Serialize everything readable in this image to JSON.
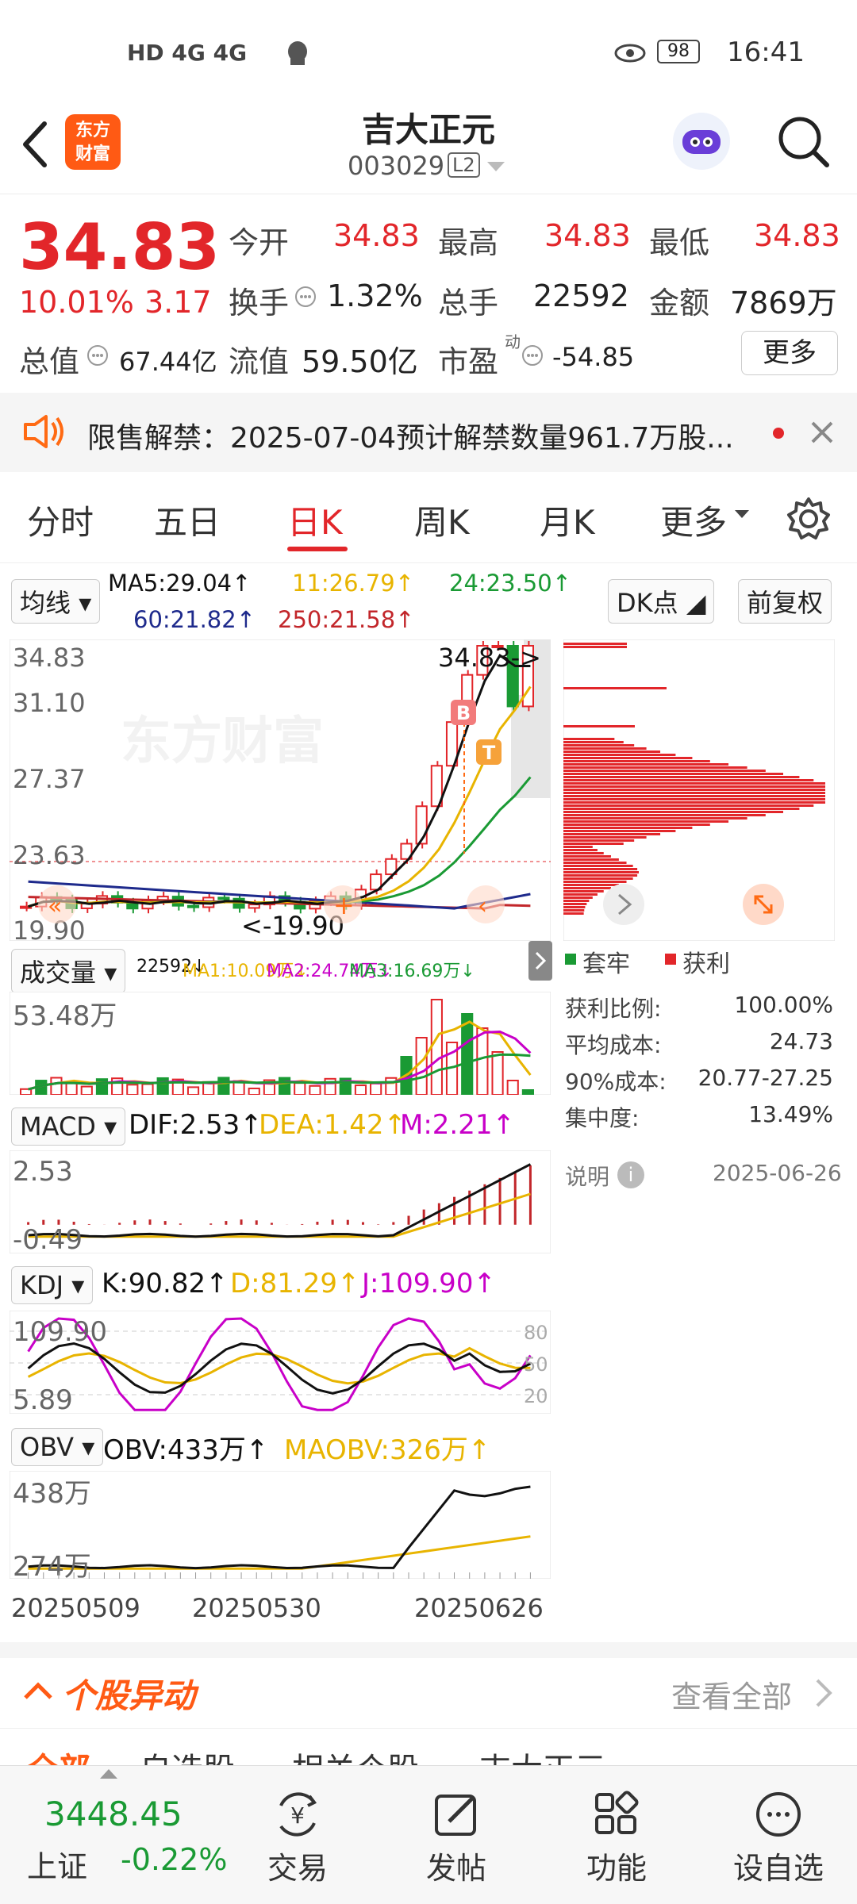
{
  "status": {
    "left_icons": "HD 4G 4G",
    "battery": "98",
    "time": "16:41"
  },
  "header": {
    "title": "吉大正元",
    "code": "003029",
    "level": "L2",
    "logo_text_1": "东方",
    "logo_text_2": "财富"
  },
  "quote": {
    "price": "34.83",
    "change_pct": "10.01%",
    "change": "3.17",
    "open_label": "今开",
    "open": "34.83",
    "high_label": "最高",
    "high": "34.83",
    "low_label": "最低",
    "low": "34.83",
    "turnover_label": "换手",
    "turnover": "1.32%",
    "volume_label": "总手",
    "volume": "22592",
    "amount_label": "金额",
    "amount": "7869万",
    "mktcap_label": "总值",
    "mktcap": "67.44亿",
    "float_label": "流值",
    "float": "59.50亿",
    "pe_label": "市盈",
    "pe_sup": "动",
    "pe": "-54.85",
    "more": "更多"
  },
  "notice": {
    "text": "限售解禁：2025-07-04预计解禁数量961.7万股..."
  },
  "tabs": [
    "分时",
    "五日",
    "日K",
    "周K",
    "月K",
    "更多",
    "设置"
  ],
  "ma": {
    "type": "均线",
    "ma5": "MA5:29.04↑",
    "ma11": "11:26.79↑",
    "ma24": "24:23.50↑",
    "ma60": "60:21.82↑",
    "ma250": "250:21.58↑",
    "dk": "DK点",
    "fq": "前复权"
  },
  "kline": {
    "p_top": "34.83",
    "p2": "31.10",
    "p3": "27.37",
    "p4": "23.63",
    "p_low": "19.90",
    "last_marker": "34.83->",
    "low_marker": "<-19.90",
    "b": "B",
    "t": "T",
    "watermark": "东方财富"
  },
  "vol": {
    "type": "成交量",
    "legend": "22592↓",
    "ma1": "MA1:10.09万↓",
    "ma2": "MA2:24.74万↓",
    "ma3": "MA3:16.69万↓",
    "max": "53.48万"
  },
  "macd": {
    "type": "MACD",
    "dif": "DIF:2.53↑",
    "dea": "DEA:1.42↑",
    "m": "M:2.21↑",
    "max": "2.53",
    "min": "-0.49"
  },
  "kdj": {
    "type": "KDJ",
    "k": "K:90.82↑",
    "d": "D:81.29↑",
    "j": "J:109.90↑",
    "max": "109.90",
    "min": "5.89",
    "l80": "80",
    "l50": "50",
    "l20": "20"
  },
  "obv": {
    "type": "OBV",
    "obv": "OBV:433万↑",
    "maobv": "MAOBV:326万↑",
    "max": "438万",
    "min": "274万"
  },
  "dates": [
    "20250509",
    "20250530",
    "20250626"
  ],
  "chips": {
    "legend_trap": "套牢",
    "legend_profit": "获利",
    "rows": [
      {
        "label": "获利比例:",
        "value": "100.00%"
      },
      {
        "label": "平均成本:",
        "value": "24.73"
      },
      {
        "label": "90%成本:",
        "value": "20.77-27.25"
      },
      {
        "label": "集中度:",
        "value": "13.49%"
      }
    ],
    "note_label": "说明",
    "note_date": "2025-06-26"
  },
  "movement": {
    "title": "个股异动",
    "view_all": "查看全部"
  },
  "subtabs": [
    "全部",
    "自选股",
    "相关个股",
    "吉大正元"
  ],
  "bottom": {
    "index_value": "3448.45",
    "index_name": "上证",
    "index_change": "-0.22%",
    "items": [
      "交易",
      "发帖",
      "功能",
      "设自选"
    ]
  },
  "colors": {
    "up": "#e2262a",
    "down": "#1a9a34",
    "ma5": "#111111",
    "ma11": "#e8b400",
    "ma24": "#1a9a34",
    "ma60": "#1e2a8c",
    "ma250": "#c2262a",
    "accent": "#ff6a13"
  }
}
